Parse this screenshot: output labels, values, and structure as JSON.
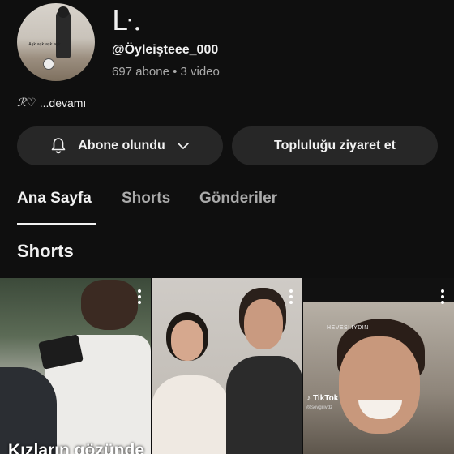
{
  "channel": {
    "logo_text": "ᒷ.",
    "handle": "@Öyleişteee_000",
    "meta": "697 abone • 3 video",
    "description": "...devamı",
    "description_sig": "ℛ♡",
    "avatar_caption": "Aşk aşk aşk aşk"
  },
  "buttons": {
    "subscribed_label": "Abone olundu",
    "community_label": "Topluluğu ziyaret et"
  },
  "tabs": [
    {
      "label": "Ana Sayfa",
      "active": true
    },
    {
      "label": "Shorts",
      "active": false
    },
    {
      "label": "Gönderiler",
      "active": false
    }
  ],
  "section": {
    "title": "Shorts"
  },
  "shorts": [
    {
      "overlay_text": "Kızların gözünde"
    },
    {
      "overlay_text": ""
    },
    {
      "overlay_text": "",
      "tiktok_label": "TikTok",
      "tiktok_user": "@sevgilivdz",
      "top_text": "HEVESLIYDIN"
    }
  ],
  "icons": {
    "bell": "bell-icon",
    "chevron": "chevron-down-icon",
    "more": "more-vertical-icon"
  }
}
